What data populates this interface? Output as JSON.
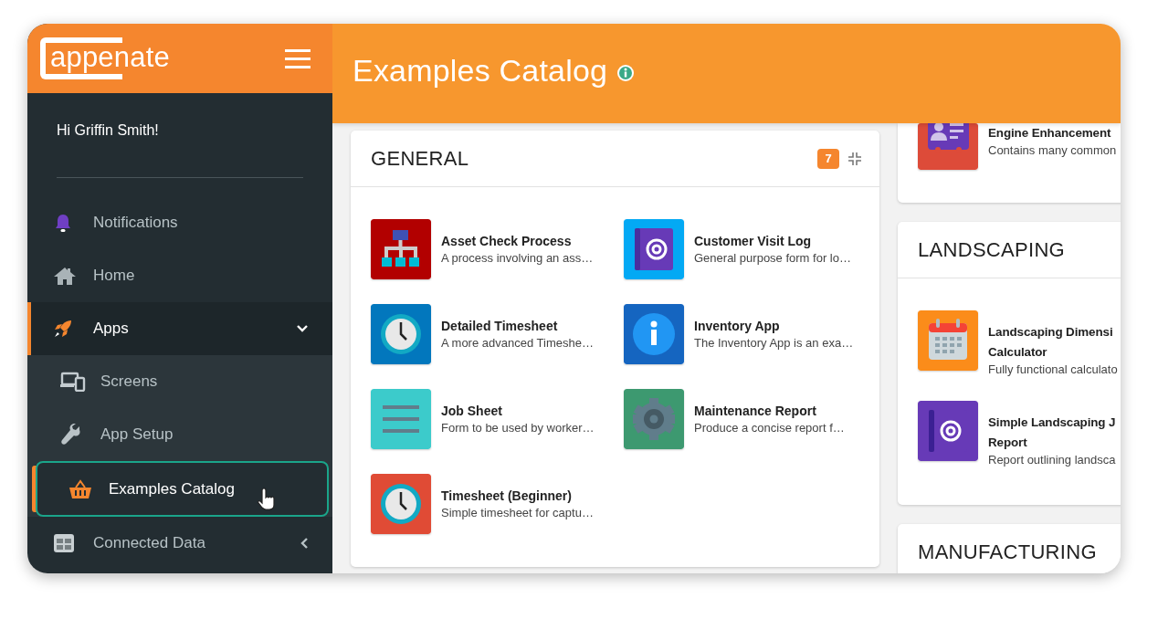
{
  "sidebar": {
    "logo": "appenate",
    "greeting": "Hi Griffin Smith!",
    "items": [
      {
        "label": "Notifications",
        "selected": false
      },
      {
        "label": "Home",
        "selected": false
      },
      {
        "label": "Apps",
        "selected": false,
        "expanded": true,
        "children": [
          {
            "label": "Screens",
            "selected": false
          },
          {
            "label": "App Setup",
            "selected": false
          },
          {
            "label": "Examples Catalog",
            "selected": true
          }
        ]
      },
      {
        "label": "Connected Data",
        "selected": false,
        "expanded": false
      }
    ]
  },
  "header": {
    "title": "Examples Catalog"
  },
  "columns": [
    [
      {
        "title": "GENERAL",
        "count": "7",
        "apps": [
          {
            "name": "Asset Check Process",
            "description": "A process involving an ass…"
          },
          {
            "name": "Customer Visit Log",
            "description": "General purpose form for lo…"
          },
          {
            "name": "Detailed Timesheet",
            "description": "A more advanced Timeshe…"
          },
          {
            "name": "Inventory App",
            "description": "The Inventory App is an exa…"
          },
          {
            "name": "Job Sheet",
            "description": "Form to be used by worker…"
          },
          {
            "name": "Maintenance Report",
            "description": "Produce a concise report f…"
          },
          {
            "name": "Timesheet (Beginner)",
            "description": "Simple timesheet for captu…"
          }
        ]
      }
    ],
    [
      {
        "apps": [
          {
            "name": "Engine Enhancement",
            "description": "Contains many common"
          }
        ]
      },
      {
        "title": "LANDSCAPING",
        "apps": [
          {
            "name": "Landscaping Dimensi\nCalculator",
            "description": "Fully functional calculato"
          },
          {
            "name": "Simple Landscaping J\nReport",
            "description": "Report outlining landsca"
          }
        ]
      },
      {
        "title": "MANUFACTURING"
      }
    ]
  ]
}
